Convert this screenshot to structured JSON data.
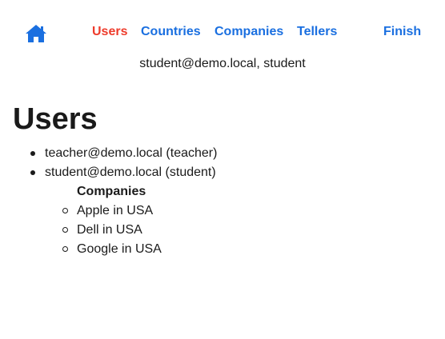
{
  "nav": {
    "home_icon": "home-icon",
    "links": {
      "users": "Users",
      "countries": "Countries",
      "companies": "Companies",
      "tellers": "Tellers",
      "finish": "Finish"
    },
    "active": "users",
    "colors": {
      "link": "#1a6fe0",
      "active": "#ee3b2b"
    }
  },
  "current_user": "student@demo.local, student",
  "page_title": "Users",
  "users": [
    {
      "label": "teacher@demo.local (teacher)"
    },
    {
      "label": "student@demo.local (student)",
      "companies_heading": "Companies",
      "companies": [
        "Apple in USA",
        "Dell in USA",
        "Google in USA"
      ]
    }
  ]
}
